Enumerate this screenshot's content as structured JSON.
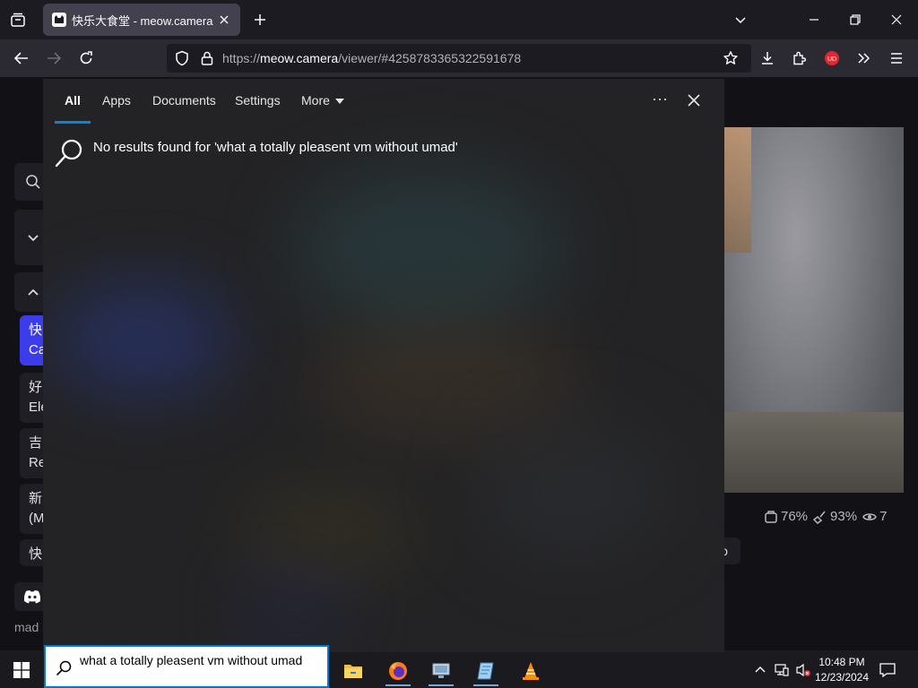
{
  "browser": {
    "tab": {
      "title": "快乐大食堂 - meow.camera"
    },
    "url": {
      "prefix": "https://",
      "host": "meow.camera",
      "path": "/viewer/#4258783365322591678"
    }
  },
  "page": {
    "side_items": [
      {
        "line1": "快",
        "line2": "Ca"
      },
      {
        "line1": "好",
        "line2": "Ele"
      },
      {
        "line1": "吉",
        "line2": "Re"
      },
      {
        "line1": "新",
        "line2": "(M"
      },
      {
        "line1": "快",
        "line2": ""
      }
    ],
    "stats": {
      "food": "76%",
      "cleanliness": "93%",
      "viewers": "7"
    },
    "pill_label": "o",
    "footer_text": "mad"
  },
  "search_panel": {
    "tabs": [
      "All",
      "Apps",
      "Documents",
      "Settings",
      "More"
    ],
    "more_options": "···",
    "no_results": "No results found for 'what a totally pleasent vm without umad'"
  },
  "taskbar": {
    "search_text": "what a totally pleasent vm without umad",
    "time": "10:48 PM",
    "date": "12/23/2024"
  },
  "colors": {
    "accent": "#0a84d6",
    "active_side_item": "#3c3ce8",
    "ublock_red": "#e3262f"
  }
}
